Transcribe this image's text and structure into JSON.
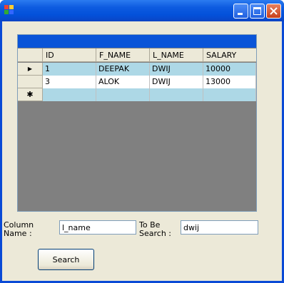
{
  "window": {
    "title": ""
  },
  "grid": {
    "columns": [
      "ID",
      "F_NAME",
      "L_NAME",
      "SALARY"
    ],
    "rows": [
      {
        "marker": "▶",
        "cells": [
          "1",
          "DEEPAK",
          "DWIJ",
          "10000"
        ]
      },
      {
        "marker": "",
        "cells": [
          "3",
          "ALOK",
          "DWIJ",
          "13000"
        ]
      },
      {
        "marker": "✱",
        "cells": [
          "",
          "",
          "",
          ""
        ]
      }
    ]
  },
  "form": {
    "column_name_label": "Column\nName :",
    "column_name_value": "l_name",
    "to_be_searched_label": "To Be\nSearch :",
    "to_be_searched_value": "dwij",
    "search_button": "Search"
  },
  "colors": {
    "title_bar": "#0351da",
    "grid_caption": "#0a54d8",
    "selected_row": "#add8e6",
    "grid_background": "#808080",
    "form_background": "#ece9d8"
  }
}
